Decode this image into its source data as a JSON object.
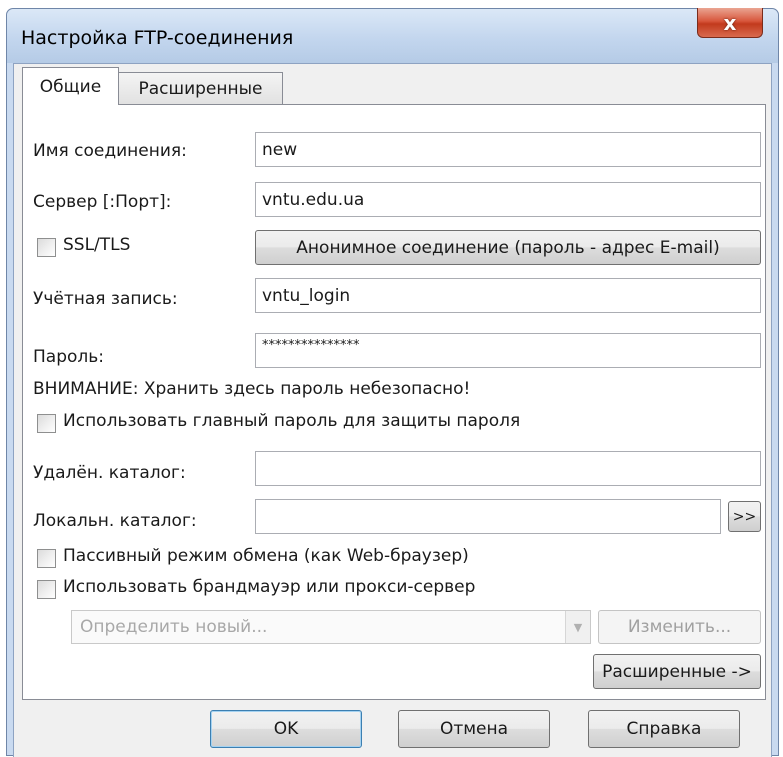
{
  "window": {
    "title": "Настройка FTP-соединения",
    "close_label": "x"
  },
  "tabs": [
    {
      "label": "Общие",
      "selected": true
    },
    {
      "label": "Расширенные",
      "selected": false
    }
  ],
  "form": {
    "connection_name_label": "Имя соединения:",
    "connection_name_value": "new",
    "server_label": "Сервер [:Порт]:",
    "server_value": "vntu.edu.ua",
    "ssl_label": "SSL/TLS",
    "ssl_checked": false,
    "anonymous_button": "Анонимное соединение (пароль - адрес E-mail)",
    "account_label": "Учётная запись:",
    "account_value": "vntu_login",
    "password_label": "Пароль:",
    "password_value": "***************",
    "warning_text": "ВНИМАНИЕ: Хранить здесь пароль небезопасно!",
    "master_password_label": "Использовать главный пароль для защиты пароля",
    "master_password_checked": false,
    "remote_dir_label": "Удалён. каталог:",
    "remote_dir_value": "",
    "local_dir_label": "Локальн. каталог:",
    "local_dir_value": "",
    "browse_button": ">>",
    "passive_label": "Пассивный режим обмена (как Web-браузер)",
    "passive_checked": false,
    "firewall_label": "Использовать брандмауэр или прокси-сервер",
    "firewall_checked": false,
    "proxy_select_value": "Определить новый...",
    "change_button": "Изменить...",
    "advanced_button": "Расширенные ->"
  },
  "footer": {
    "ok_button": "OK",
    "cancel_button": "Отмена",
    "help_button": "Справка"
  }
}
